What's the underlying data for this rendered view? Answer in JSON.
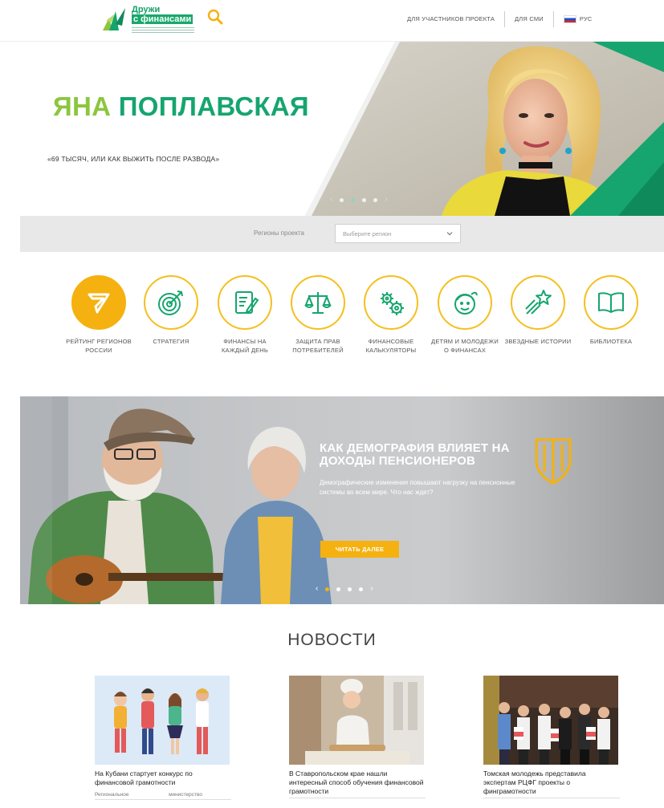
{
  "header": {
    "logo_line1": "Дружи",
    "logo_line2": "с финансами",
    "nav": {
      "participants": "ДЛЯ УЧАСТНИКОВ ПРОЕКТА",
      "media": "ДЛЯ СМИ",
      "lang": "РУС"
    }
  },
  "hero": {
    "name_first": "ЯНА",
    "name_last": "ПОПЛАВСКАЯ",
    "subtitle": "«69 ТЫСЯЧ, ИЛИ КАК ВЫЖИТЬ ПОСЛЕ РАЗВОДА»",
    "slides_count": 4,
    "active_slide": 2
  },
  "region": {
    "label": "Регионы проекта",
    "placeholder": "Выберите регион"
  },
  "categories": [
    {
      "label": "РЕЙТИНГ РЕГИОНОВ РОССИИ",
      "icon": "rating-icon",
      "active": true
    },
    {
      "label": "СТРАТЕГИЯ",
      "icon": "target-icon",
      "active": false
    },
    {
      "label": "ФИНАНСЫ НА КАЖДЫЙ ДЕНЬ",
      "icon": "document-pen-icon",
      "active": false
    },
    {
      "label": "ЗАЩИТА ПРАВ ПОТРЕБИТЕЛЕЙ",
      "icon": "scales-icon",
      "active": false
    },
    {
      "label": "ФИНАНСОВЫЕ КАЛЬКУЛЯТОРЫ",
      "icon": "gears-icon",
      "active": false
    },
    {
      "label": "ДЕТЯМ И МОЛОДЕЖИ О ФИНАНСАХ",
      "icon": "child-face-icon",
      "active": false
    },
    {
      "label": "ЗВЕЗДНЫЕ ИСТОРИИ",
      "icon": "shooting-star-icon",
      "active": false
    },
    {
      "label": "БИБЛИОТЕКА",
      "icon": "book-icon",
      "active": false
    }
  ],
  "feature": {
    "title": "КАК ДЕМОГРАФИЯ ВЛИЯЕТ НА ДОХОДЫ ПЕНСИОНЕРОВ",
    "text": "Демографические изменения повышают нагрузку на пенсионные системы во всем мире. Что нас ждет?",
    "button": "ЧИТАТЬ ДАЛЕЕ",
    "slides_count": 4,
    "active_slide": 1
  },
  "news": {
    "title": "НОВОСТИ",
    "items": [
      {
        "headline": "На Кубани стартует конкурс по финансовой грамотности",
        "tag1": "Региональное",
        "tag2": "министерство"
      },
      {
        "headline": "В Ставропольском крае нашли интересный способ обучения финансовой грамотности",
        "tag1": "",
        "tag2": ""
      },
      {
        "headline": "Томская молодежь представила экспертам РЦФГ проекты о финграмотности",
        "tag1": "",
        "tag2": ""
      }
    ]
  },
  "colors": {
    "green": "#16a56f",
    "light_green": "#8cc63f",
    "yellow": "#f5b10f",
    "region_bar": "#e8e8e8"
  }
}
